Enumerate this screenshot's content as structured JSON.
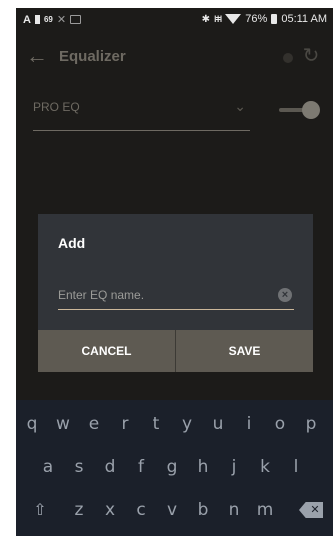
{
  "statusbar": {
    "left_a": "A",
    "left_num": "69",
    "battery_pct": "76%",
    "time": "05:11 AM"
  },
  "appbar": {
    "title": "Equalizer"
  },
  "preset": {
    "label": "PRO EQ"
  },
  "dialog": {
    "title": "Add",
    "input_placeholder": "Enter EQ name.",
    "cancel_label": "CANCEL",
    "save_label": "SAVE"
  },
  "keyboard": {
    "row1": [
      "q",
      "w",
      "e",
      "r",
      "t",
      "y",
      "u",
      "i",
      "o",
      "p"
    ],
    "row2": [
      "a",
      "s",
      "d",
      "f",
      "g",
      "h",
      "j",
      "k",
      "l"
    ],
    "row3": [
      "z",
      "x",
      "c",
      "v",
      "b",
      "n",
      "m"
    ]
  },
  "colors": {
    "background": "#1c1b19",
    "dialog": "#313439",
    "dialog_buttons": "#5e5a52",
    "input_underline": "#cbb79a",
    "keyboard": "#1b202a"
  }
}
